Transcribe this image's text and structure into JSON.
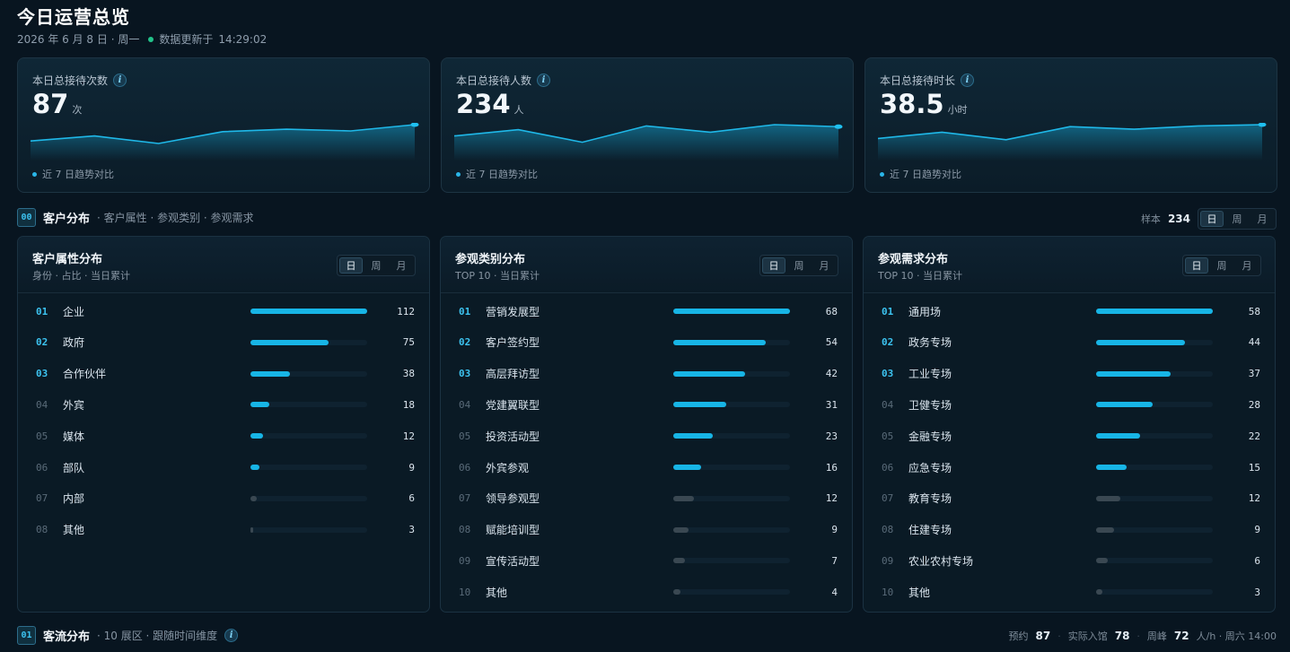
{
  "header": {
    "title": "今日运营总览",
    "date": "2026 年 6 月 8 日 · 周一",
    "update_label": "数据更新于",
    "update_time": "14:29:02"
  },
  "kpis": [
    {
      "label": "本日总接待次数",
      "value": "87",
      "unit": "次",
      "foot": "近 7 日趋势对比",
      "trend": [
        0.35,
        0.55,
        0.25,
        0.72,
        0.82,
        0.75,
        1.0
      ]
    },
    {
      "label": "本日总接待人数",
      "value": "234",
      "unit": "人",
      "foot": "近 7 日趋势对比",
      "trend": [
        0.55,
        0.8,
        0.3,
        0.95,
        0.7,
        1.0,
        0.92
      ]
    },
    {
      "label": "本日总接待时长",
      "value": "38.5",
      "unit": "小时",
      "foot": "近 7 日趋势对比",
      "trend": [
        0.45,
        0.7,
        0.4,
        0.92,
        0.82,
        0.95,
        1.0
      ]
    }
  ],
  "section0": {
    "badge": "00",
    "title": "客户分布",
    "subtitle": "· 客户属性 · 参观类别 · 参观需求",
    "sample_label": "样本",
    "sample_value": "234",
    "segments": [
      "日",
      "周",
      "月"
    ]
  },
  "panels": [
    {
      "title": "客户属性分布",
      "subtitle": "身份 · 占比 · 当日累计",
      "segments": [
        "日",
        "周",
        "月"
      ],
      "max": 112,
      "rows": [
        {
          "idx": "01",
          "name": "企业",
          "value": 112
        },
        {
          "idx": "02",
          "name": "政府",
          "value": 75
        },
        {
          "idx": "03",
          "name": "合作伙伴",
          "value": 38
        },
        {
          "idx": "04",
          "name": "外宾",
          "value": 18
        },
        {
          "idx": "05",
          "name": "媒体",
          "value": 12
        },
        {
          "idx": "06",
          "name": "部队",
          "value": 9
        },
        {
          "idx": "07",
          "name": "内部",
          "value": 6
        },
        {
          "idx": "08",
          "name": "其他",
          "value": 3
        }
      ]
    },
    {
      "title": "参观类别分布",
      "subtitle": "TOP 10 · 当日累计",
      "segments": [
        "日",
        "周",
        "月"
      ],
      "max": 68,
      "rows": [
        {
          "idx": "01",
          "name": "营销发展型",
          "value": 68
        },
        {
          "idx": "02",
          "name": "客户签约型",
          "value": 54
        },
        {
          "idx": "03",
          "name": "高层拜访型",
          "value": 42
        },
        {
          "idx": "04",
          "name": "党建翼联型",
          "value": 31
        },
        {
          "idx": "05",
          "name": "投资活动型",
          "value": 23
        },
        {
          "idx": "06",
          "name": "外宾参观",
          "value": 16
        },
        {
          "idx": "07",
          "name": "领导参观型",
          "value": 12
        },
        {
          "idx": "08",
          "name": "赋能培训型",
          "value": 9
        },
        {
          "idx": "09",
          "name": "宣传活动型",
          "value": 7
        },
        {
          "idx": "10",
          "name": "其他",
          "value": 4
        }
      ]
    },
    {
      "title": "参观需求分布",
      "subtitle": "TOP 10 · 当日累计",
      "segments": [
        "日",
        "周",
        "月"
      ],
      "max": 58,
      "rows": [
        {
          "idx": "01",
          "name": "通用场",
          "value": 58
        },
        {
          "idx": "02",
          "name": "政务专场",
          "value": 44
        },
        {
          "idx": "03",
          "name": "工业专场",
          "value": 37
        },
        {
          "idx": "04",
          "name": "卫健专场",
          "value": 28
        },
        {
          "idx": "05",
          "name": "金融专场",
          "value": 22
        },
        {
          "idx": "06",
          "name": "应急专场",
          "value": 15
        },
        {
          "idx": "07",
          "name": "教育专场",
          "value": 12
        },
        {
          "idx": "08",
          "name": "住建专场",
          "value": 9
        },
        {
          "idx": "09",
          "name": "农业农村专场",
          "value": 6
        },
        {
          "idx": "10",
          "name": "其他",
          "value": 3
        }
      ]
    }
  ],
  "section1": {
    "badge": "01",
    "title": "客流分布",
    "subtitle": "· 10 展区 · 跟随时间维度",
    "booked_label": "预约",
    "booked_value": "87",
    "actual_label": "实际入馆",
    "actual_value": "78",
    "peak_label": "周峰",
    "peak_value": "72",
    "peak_unit": "人/h · 周六 14:00"
  },
  "colors": {
    "accent": "#17b5e6",
    "background": "#081520",
    "dim_bar": "#3a4852"
  }
}
